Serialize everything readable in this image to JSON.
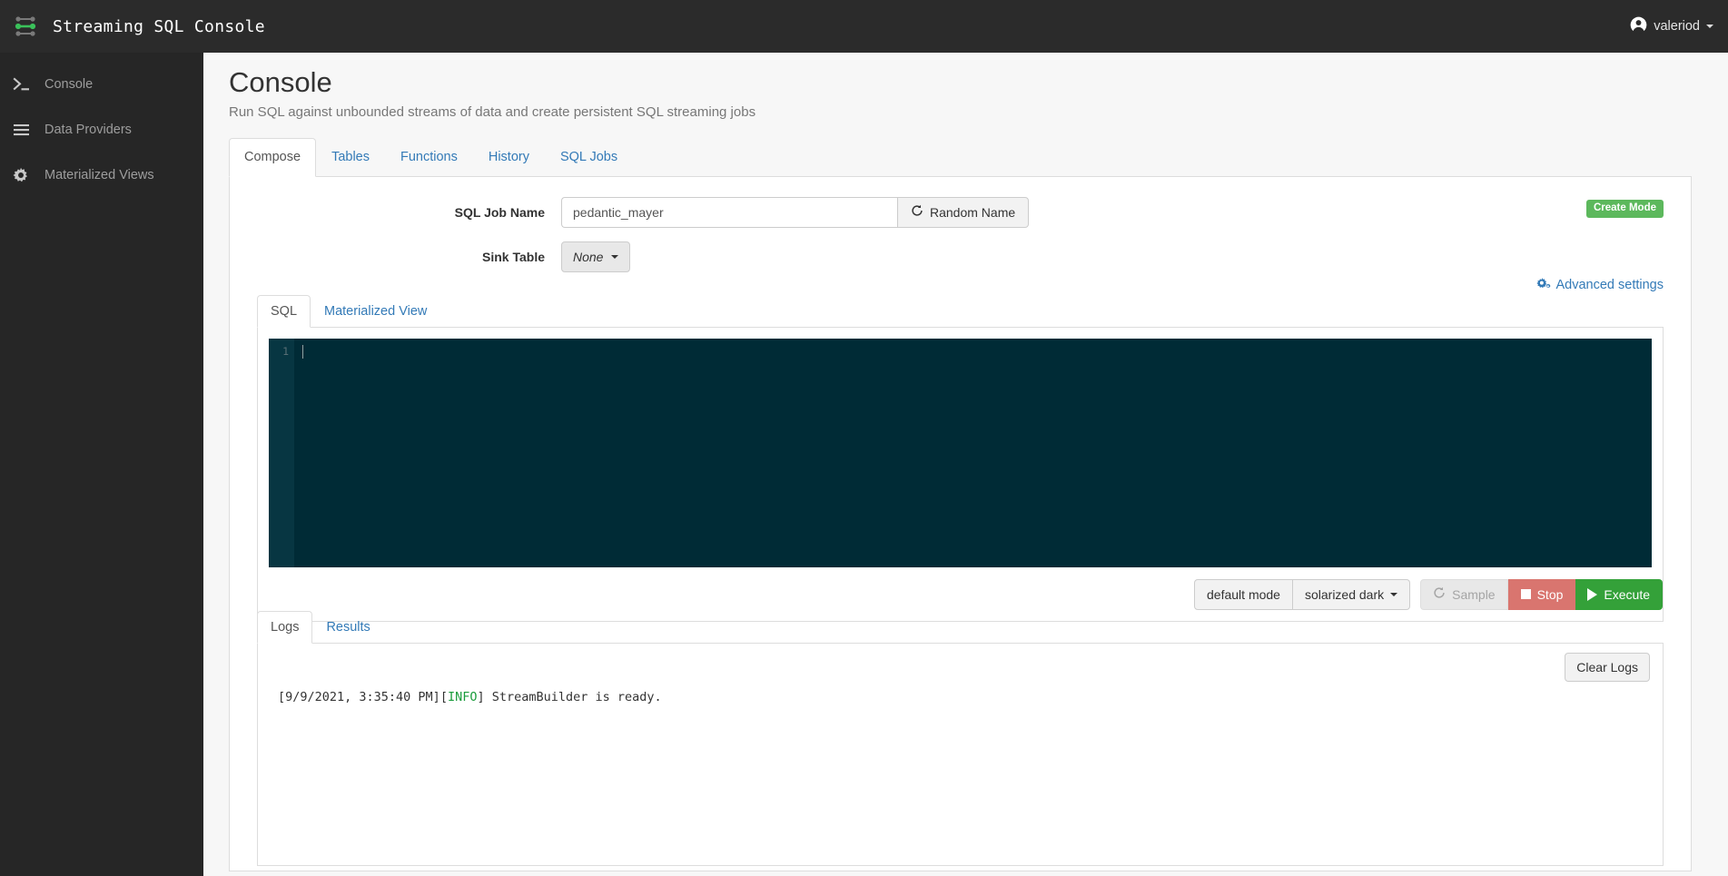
{
  "navbar": {
    "brand_title": "Streaming SQL Console",
    "brand_logo_icon": "graph-nodes-icon",
    "accent_green": "#3ac15a",
    "background": "#2b2b2b",
    "user": {
      "name": "valeriod",
      "avatar_icon": "user-circle-icon",
      "caret_icon": "caret-down-icon"
    }
  },
  "sidebar": {
    "items": [
      {
        "label": "Console",
        "icon": "terminal-prompt-icon"
      },
      {
        "label": "Data Providers",
        "icon": "bars-icon"
      },
      {
        "label": "Materialized Views",
        "icon": "gear-icon"
      }
    ]
  },
  "page": {
    "title": "Console",
    "subtitle": "Run SQL against unbounded streams of data and create persistent SQL streaming jobs"
  },
  "tabs": {
    "items": [
      {
        "label": "Compose",
        "active": true
      },
      {
        "label": "Tables",
        "active": false
      },
      {
        "label": "Functions",
        "active": false
      },
      {
        "label": "History",
        "active": false
      },
      {
        "label": "SQL Jobs",
        "active": false
      }
    ]
  },
  "compose": {
    "mode_badge": "Create Mode",
    "mode_badge_color": "#5cb85c",
    "job_name": {
      "label": "SQL Job Name",
      "value": "pedantic_mayer",
      "placeholder": "SQL Job Name",
      "button_label": "Random Name",
      "button_icon": "refresh-icon"
    },
    "sink_table": {
      "label": "Sink Table",
      "selected": "None",
      "caret_icon": "caret-down-icon"
    },
    "advanced_settings": {
      "label": "Advanced settings",
      "icon": "cogs-icon"
    }
  },
  "editor": {
    "tabs": [
      {
        "label": "SQL",
        "active": true
      },
      {
        "label": "Materialized View",
        "active": false
      }
    ],
    "line_numbers": [
      "1"
    ],
    "content": "",
    "theme_background": "#002b36",
    "gutter_background": "#073642",
    "toolbar": {
      "keymap_label": "default mode",
      "theme_label": "solarized dark",
      "theme_caret_icon": "caret-down-icon",
      "sample_label": "Sample",
      "sample_icon": "refresh-icon",
      "sample_disabled": true,
      "stop_label": "Stop",
      "stop_icon": "stop-square-icon",
      "stop_color": "#d9756f",
      "execute_label": "Execute",
      "execute_icon": "play-icon",
      "execute_color": "#34a139"
    }
  },
  "output": {
    "tabs": [
      {
        "label": "Logs",
        "active": true
      },
      {
        "label": "Results",
        "active": false
      }
    ],
    "clear_logs_label": "Clear Logs",
    "log_lines": [
      {
        "timestamp": "[9/9/2021, 3:35:40 PM]",
        "level_open": "[",
        "level": "INFO",
        "level_close": "]",
        "message": " StreamBuilder is ready.",
        "level_color": "#1a9c3c"
      }
    ]
  }
}
